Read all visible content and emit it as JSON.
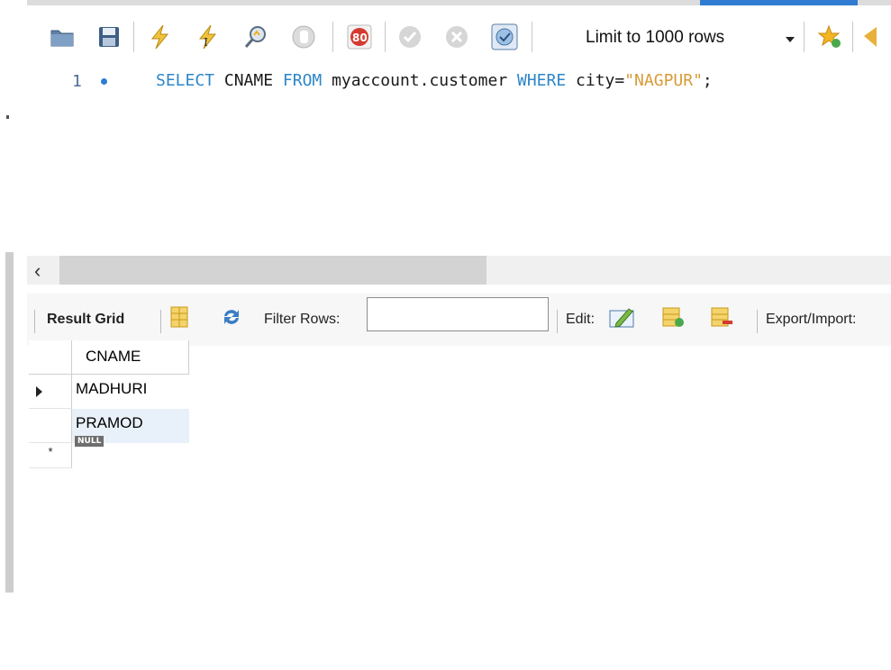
{
  "toolbar": {
    "limit_label": "Limit to 1000 rows",
    "icons": [
      "open-folder-icon",
      "save-icon",
      "execute-icon",
      "execute-current-icon",
      "explain-icon",
      "stop-icon",
      "toggle-error-icon",
      "commit-icon",
      "rollback-icon",
      "autocommit-icon",
      "favorite-add-icon"
    ]
  },
  "editor": {
    "line_number": "1",
    "code": {
      "kw1": "SELECT",
      "t1": " CNAME ",
      "kw2": "FROM",
      "t2": " myaccount.customer ",
      "kw3": "WHERE",
      "t3": " city=",
      "str": "\"NAGPUR\"",
      "t4": ";"
    }
  },
  "result_toolbar": {
    "result_grid": "Result Grid",
    "filter_rows": "Filter Rows:",
    "filter_value": "",
    "edit": "Edit:",
    "export_import": "Export/Import:"
  },
  "grid": {
    "column": "CNAME",
    "rows": [
      "MADHURI",
      "PRAMOD"
    ],
    "new_row_marker": "*",
    "null_badge": "NULL"
  },
  "colors": {
    "keyword": "#2d86c8",
    "string": "#d79b37",
    "selected_row": "#e8f1f9"
  }
}
